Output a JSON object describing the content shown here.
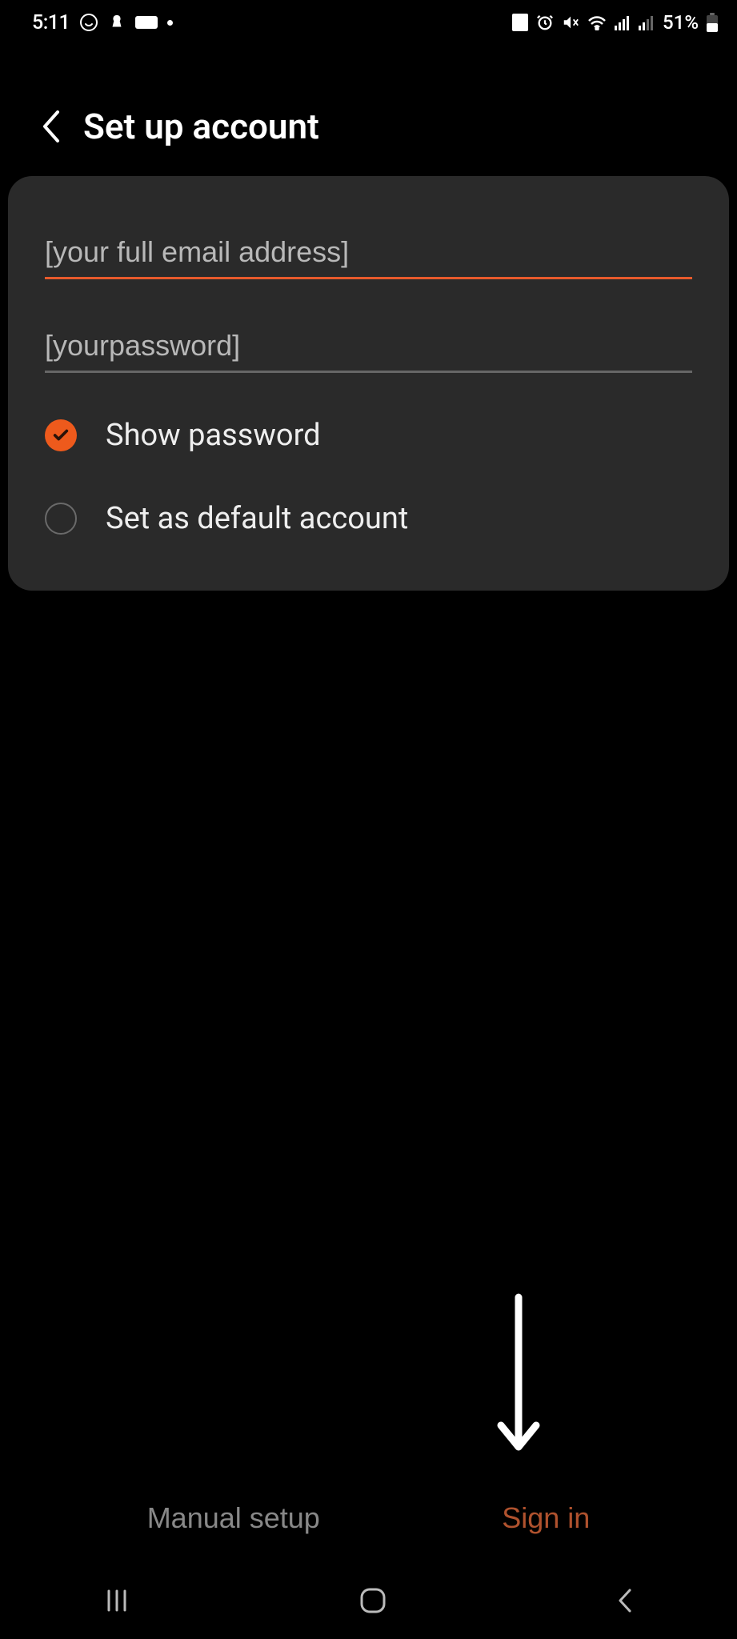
{
  "statusbar": {
    "time": "5:11",
    "battery": "51%"
  },
  "header": {
    "title": "Set up account"
  },
  "form": {
    "email_value": "[your full email address]",
    "password_value": "[yourpassword]",
    "show_password_label": "Show password",
    "default_account_label": "Set as default account"
  },
  "actions": {
    "manual_setup": "Manual setup",
    "sign_in": "Sign in"
  },
  "colors": {
    "accent": "#ee5a1c",
    "card_bg": "#2a2a2a",
    "sign_in": "#b0522e"
  }
}
